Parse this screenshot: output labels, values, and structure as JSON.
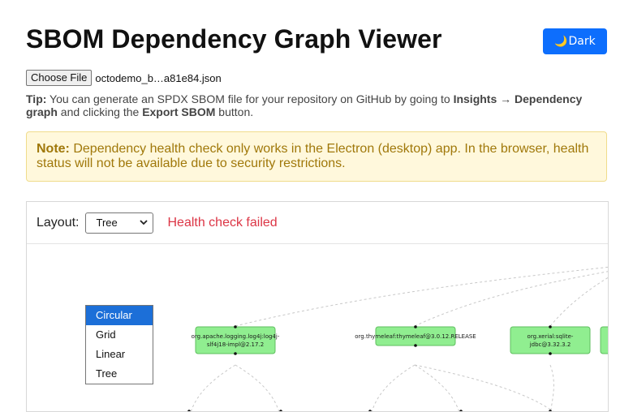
{
  "header": {
    "title": "SBOM Dependency Graph Viewer",
    "theme_button": {
      "icon": "moon-icon",
      "icon_glyph": "🌙",
      "label": "Dark"
    }
  },
  "file_input": {
    "button_label": "Choose File",
    "file_name": "octodemo_b…a81e84.json"
  },
  "tip": {
    "prefix": "Tip:",
    "text1": " You can generate an SPDX SBOM file for your repository on GitHub by going to ",
    "bold1": "Insights → Dependency graph",
    "text2": " and clicking the ",
    "bold2": "Export SBOM",
    "text3": " button."
  },
  "note": {
    "prefix": "Note:",
    "text": " Dependency health check only works in the Electron (desktop) app. In the browser, health status will not be available due to security restrictions."
  },
  "graph": {
    "layout_label": "Layout:",
    "layout_selected": "Tree",
    "layout_options": [
      "Circular",
      "Grid",
      "Linear",
      "Tree"
    ],
    "highlighted_option": "Circular",
    "health_status": "Health check failed",
    "node_color": "#90ee90",
    "node_border": "#5fbf5f",
    "nodes": [
      {
        "label": "org.apache.logging.log4j:log4j-slf4j18-impl@2.17.2"
      },
      {
        "label": "org.thymeleaf:thymeleaf@3.0.12.RELEASE"
      },
      {
        "label": "org.xerial:sqlite-jdbc@3.32.3.2"
      },
      {
        "label": ""
      }
    ]
  },
  "colors": {
    "accent": "#0d6efd",
    "error": "#dc3545",
    "note_bg": "#fff8dc",
    "note_text": "#a0780a"
  }
}
